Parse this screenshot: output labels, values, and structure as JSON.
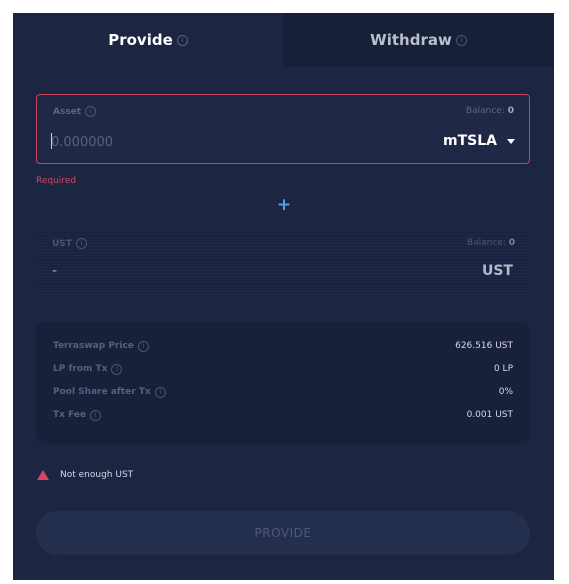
{
  "tabs": {
    "provide": "Provide",
    "withdraw": "Withdraw",
    "info_glyph": "i"
  },
  "asset": {
    "label": "Asset",
    "balance_label": "Balance:",
    "balance_value": "0",
    "placeholder": "0.000000",
    "token": "mTSLA",
    "error": "Required"
  },
  "plus_symbol": "+",
  "ust": {
    "label": "UST",
    "balance_label": "Balance:",
    "balance_value": "0",
    "value": "-",
    "symbol": "UST"
  },
  "summary": [
    {
      "label": "Terraswap Price",
      "value": "626.516 UST"
    },
    {
      "label": "LP from Tx",
      "value": "0 LP"
    },
    {
      "label": "Pool Share after Tx",
      "value": "0%"
    },
    {
      "label": "Tx Fee",
      "value": "0.001 UST"
    }
  ],
  "warning": "Not enough UST",
  "submit_label": "PROVIDE",
  "colors": {
    "panel": "#1c2643",
    "error": "#d2465f",
    "accent": "#48a4ea"
  }
}
